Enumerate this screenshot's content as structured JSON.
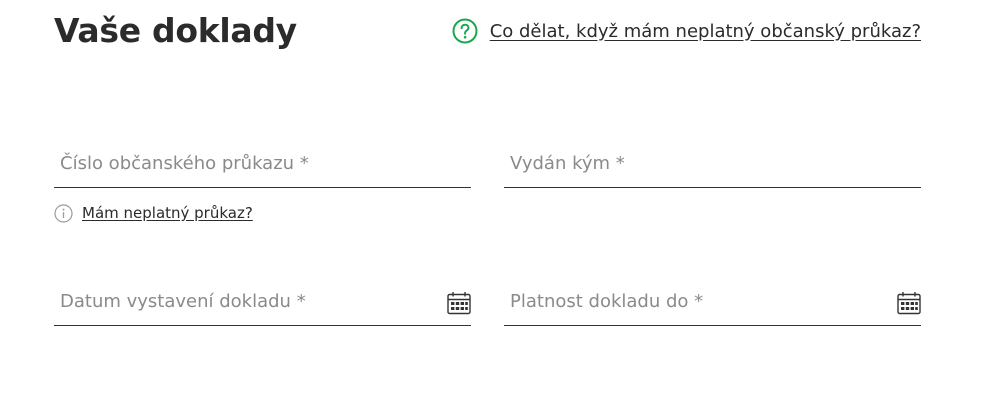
{
  "header": {
    "title": "Vaše doklady",
    "help_link": "Co dělat, když mám neplatný občanský průkaz?",
    "help_icon": "question-circle-icon",
    "accent_color": "#1aa84f"
  },
  "form": {
    "id_number": {
      "label": "Číslo občanského průkazu *",
      "value": ""
    },
    "issued_by": {
      "label": "Vydán kým *",
      "value": ""
    },
    "invalid_hint": {
      "link": "Mám neplatný průkaz?",
      "icon": "info-circle-icon"
    },
    "issue_date": {
      "label": "Datum vystavení dokladu *",
      "value": "",
      "icon": "calendar-icon"
    },
    "valid_until": {
      "label": "Platnost dokladu do *",
      "value": "",
      "icon": "calendar-icon"
    }
  }
}
